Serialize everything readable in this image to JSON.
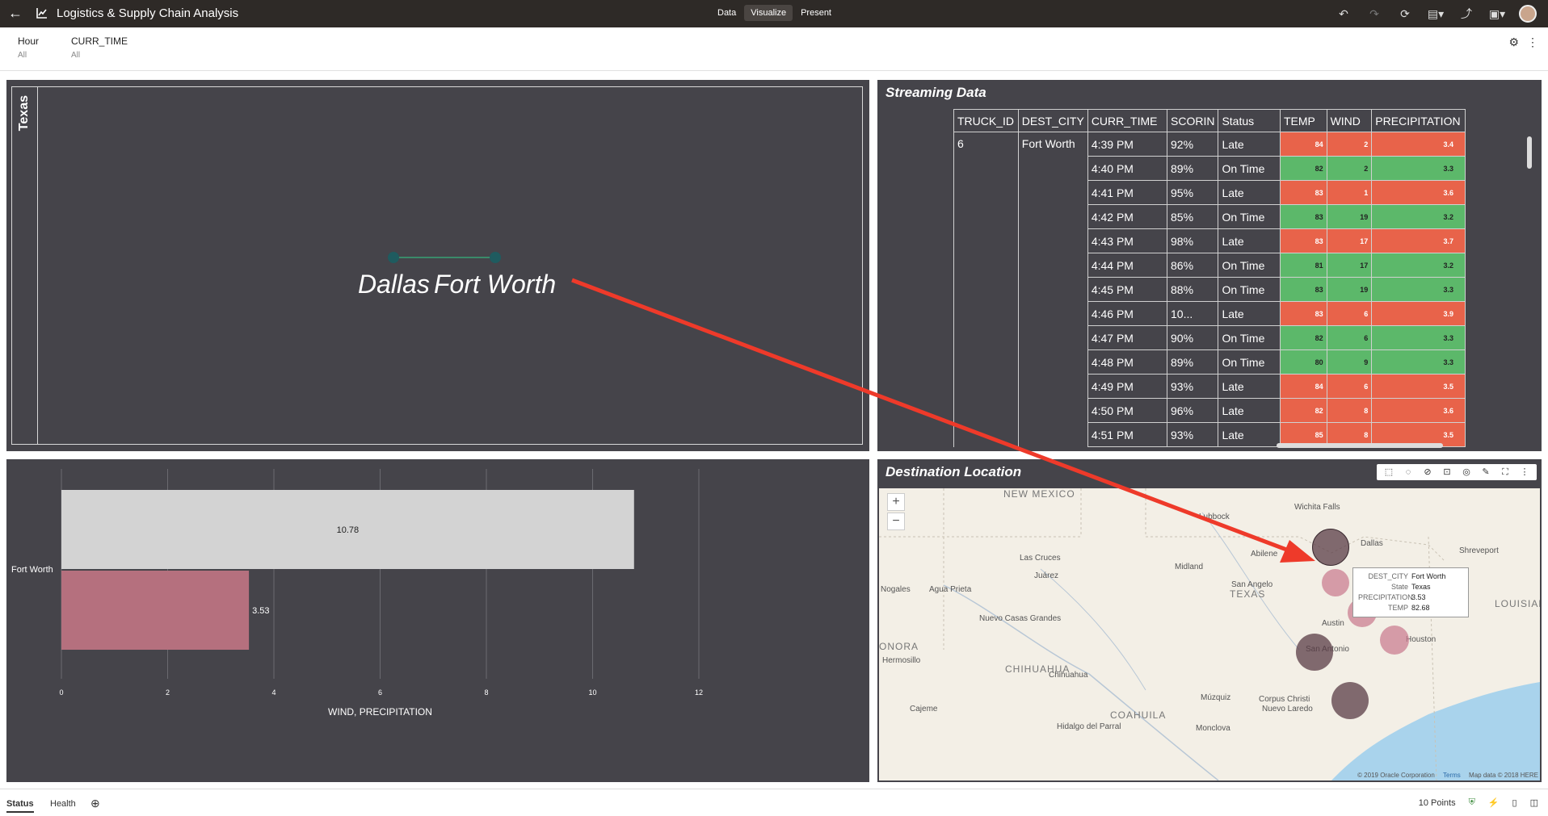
{
  "header": {
    "title": "Logistics & Supply Chain Analysis",
    "modes": [
      "Data",
      "Visualize",
      "Present"
    ],
    "active_mode": "Visualize"
  },
  "filters": [
    {
      "name": "Hour",
      "value": "All"
    },
    {
      "name": "CURR_TIME",
      "value": "All"
    }
  ],
  "texas_panel": {
    "label": "Texas",
    "cities": [
      "Dallas",
      "Fort Worth"
    ]
  },
  "streaming": {
    "title": "Streaming Data",
    "columns": [
      "TRUCK_ID",
      "DEST_CITY",
      "CURR_TIME",
      "SCORIN",
      "Status",
      "TEMP",
      "WIND",
      "PRECIPITATION"
    ],
    "truck_id": "6",
    "dest_city": "Fort Worth",
    "rows": [
      {
        "time": "4:39 PM",
        "score": "92%",
        "status": "Late",
        "temp": "84",
        "wind": "2",
        "precip": "3.4"
      },
      {
        "time": "4:40 PM",
        "score": "89%",
        "status": "On Time",
        "temp": "82",
        "wind": "2",
        "precip": "3.3"
      },
      {
        "time": "4:41 PM",
        "score": "95%",
        "status": "Late",
        "temp": "83",
        "wind": "1",
        "precip": "3.6"
      },
      {
        "time": "4:42 PM",
        "score": "85%",
        "status": "On Time",
        "temp": "83",
        "wind": "19",
        "precip": "3.2"
      },
      {
        "time": "4:43 PM",
        "score": "98%",
        "status": "Late",
        "temp": "83",
        "wind": "17",
        "precip": "3.7"
      },
      {
        "time": "4:44 PM",
        "score": "86%",
        "status": "On Time",
        "temp": "81",
        "wind": "17",
        "precip": "3.2"
      },
      {
        "time": "4:45 PM",
        "score": "88%",
        "status": "On Time",
        "temp": "83",
        "wind": "19",
        "precip": "3.3"
      },
      {
        "time": "4:46 PM",
        "score": "10...",
        "status": "Late",
        "temp": "83",
        "wind": "6",
        "precip": "3.9"
      },
      {
        "time": "4:47 PM",
        "score": "90%",
        "status": "On Time",
        "temp": "82",
        "wind": "6",
        "precip": "3.3"
      },
      {
        "time": "4:48 PM",
        "score": "89%",
        "status": "On Time",
        "temp": "80",
        "wind": "9",
        "precip": "3.3"
      },
      {
        "time": "4:49 PM",
        "score": "93%",
        "status": "Late",
        "temp": "84",
        "wind": "6",
        "precip": "3.5"
      },
      {
        "time": "4:50 PM",
        "score": "96%",
        "status": "Late",
        "temp": "82",
        "wind": "8",
        "precip": "3.6"
      },
      {
        "time": "4:51 PM",
        "score": "93%",
        "status": "Late",
        "temp": "85",
        "wind": "8",
        "precip": "3.5"
      }
    ],
    "colors": {
      "late": "#e8634a",
      "on_time": "#5cb86a"
    }
  },
  "chart_data": {
    "type": "bar",
    "orientation": "horizontal",
    "categories": [
      "Fort Worth"
    ],
    "series": [
      {
        "name": "WIND",
        "values": [
          10.78
        ],
        "color": "#d3d3d3"
      },
      {
        "name": "PRECIPITATION",
        "values": [
          3.53
        ],
        "color": "#b5707e"
      }
    ],
    "xlabel": "WIND, PRECIPITATION",
    "xlim": [
      0,
      12
    ],
    "xticks": [
      "0",
      "2",
      "4",
      "6",
      "8",
      "10",
      "12"
    ],
    "grid": true
  },
  "map": {
    "title": "Destination Location",
    "places": [
      "NEW MEXICO",
      "Lubbock",
      "Wichita Falls",
      "Dallas",
      "Shreveport",
      "Las Cruces",
      "Abilene",
      "Midland",
      "Juárez",
      "San Angelo",
      "TEXAS",
      "LOUISIANA",
      "Nogales",
      "Agua Prieta",
      "Nuevo Casas Grandes",
      "Austin",
      "ONORA",
      "Hermosillo",
      "San Antonio",
      "Houston",
      "CHIHUAHUA",
      "Chihuahua",
      "Múzquiz",
      "Corpus Christi",
      "Nuevo Laredo",
      "Cajeme",
      "COAHUILA",
      "Hidalgo del Parral",
      "Monclova"
    ],
    "tooltip": [
      {
        "key": "DEST_CITY",
        "value": "Fort Worth"
      },
      {
        "key": "State",
        "value": "Texas"
      },
      {
        "key": "PRECIPITATION",
        "value": "3.53"
      },
      {
        "key": "TEMP",
        "value": "82.68"
      }
    ],
    "credits": [
      "© 2019 Oracle Corporation",
      "Terms",
      "Map data © 2018 HERE"
    ],
    "zoom_in": "+",
    "zoom_out": "−"
  },
  "statusbar": {
    "tabs": [
      "Status",
      "Health"
    ],
    "active_tab": "Status",
    "points": "10 Points"
  }
}
